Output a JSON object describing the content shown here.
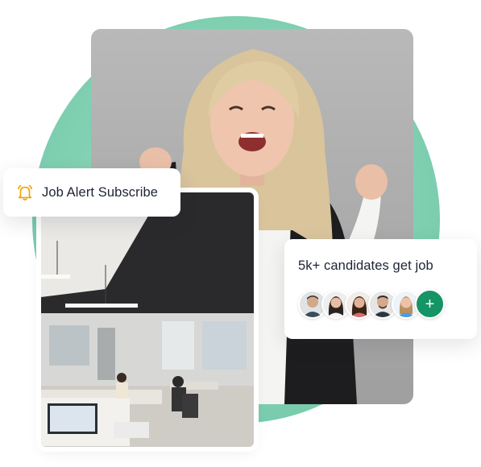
{
  "job_alert": {
    "label": "Job Alert Subscribe",
    "icon": "bell-icon",
    "icon_color": "#f2a007"
  },
  "candidates": {
    "title": "5k+ candidates get job",
    "avatars": [
      "avatar-1",
      "avatar-2",
      "avatar-3",
      "avatar-4",
      "avatar-5"
    ],
    "add_symbol": "+",
    "add_color": "#159466"
  },
  "colors": {
    "circle": "#7fcfb1",
    "text": "#1c2434"
  }
}
